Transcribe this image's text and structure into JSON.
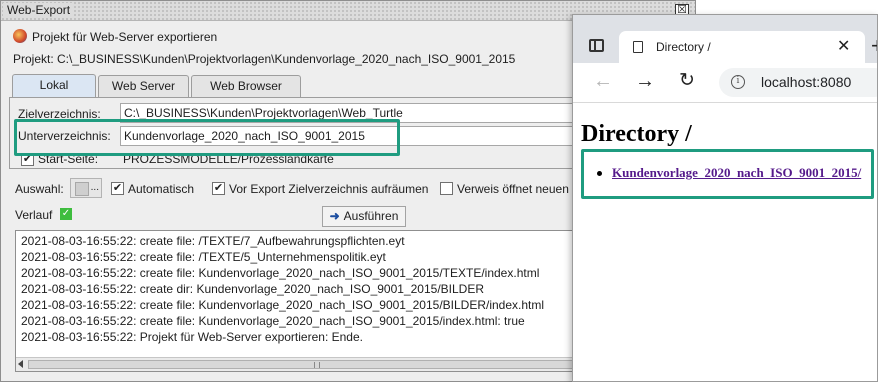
{
  "dialog": {
    "title": "Web-Export",
    "close_glyph": "☒",
    "header": "Projekt für Web-Server exportieren",
    "project_line": "Projekt: C:\\_BUSINESS\\Kunden\\Projektvorlagen\\Kundenvorlage_2020_nach_ISO_9001_2015",
    "tabs": [
      {
        "label": "Lokal",
        "active": true
      },
      {
        "label": "Web Server",
        "active": false
      },
      {
        "label": "Web Browser",
        "active": false
      }
    ],
    "target_dir": {
      "label": "Zielverzeichnis:",
      "value": "C:\\_BUSINESS\\Kunden\\Projektvorlagen\\Web_Turtle"
    },
    "sub_dir": {
      "label": "Unterverzeichnis:",
      "value": "Kundenvorlage_2020_nach_ISO_9001_2015"
    },
    "start_page": {
      "label": "Start-Seite:",
      "value": "PROZESSMODELLE/Prozesslandkarte",
      "checked": true
    },
    "selection": {
      "label": "Auswahl:",
      "button_text": "...",
      "automatic": {
        "label": "Automatisch",
        "checked": true
      },
      "cleanup": {
        "label": "Vor Export Zielverzeichnis aufräumen",
        "checked": true
      },
      "link_new": {
        "label": "Verweis öffnet neuen",
        "checked": false
      }
    },
    "history_label": "Verlauf",
    "run_button": "Ausführen",
    "log": [
      "2021-08-03-16:55:22: create file: /TEXTE/7_Aufbewahrungspflichten.eyt",
      "2021-08-03-16:55:22: create file: /TEXTE/5_Unternehmenspolitik.eyt",
      "2021-08-03-16:55:22: create file: Kundenvorlage_2020_nach_ISO_9001_2015/TEXTE/index.html",
      "2021-08-03-16:55:22: create dir: Kundenvorlage_2020_nach_ISO_9001_2015/BILDER",
      "2021-08-03-16:55:22: create file: Kundenvorlage_2020_nach_ISO_9001_2015/BILDER/index.html",
      "2021-08-03-16:55:22: create file: Kundenvorlage_2020_nach_ISO_9001_2015/index.html: true",
      "2021-08-03-16:55:22: Projekt für Web-Server exportieren: Ende."
    ]
  },
  "browser": {
    "tab_title": "Directory /",
    "url": "localhost:8080",
    "heading": "Directory /",
    "links": [
      "Kundenvorlage_2020_nach_ISO_9001_2015/"
    ]
  },
  "colors": {
    "highlight": "#1f9c80",
    "link_visited": "#551a8b",
    "tab_active": "#dbe6f3"
  }
}
